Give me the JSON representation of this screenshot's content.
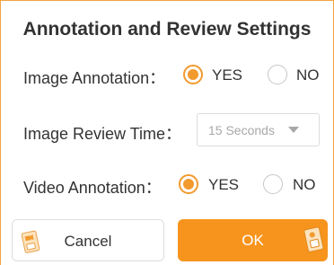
{
  "dialog": {
    "title": "Annotation and Review Settings"
  },
  "rows": {
    "image_annotation": {
      "label": "Image Annotation：",
      "yes": "YES",
      "no": "NO",
      "selected": "YES"
    },
    "review_time": {
      "label": "Image Review Time：",
      "value": "15 Seconds"
    },
    "video_annotation": {
      "label": "Video Annotation：",
      "yes": "YES",
      "no": "NO",
      "selected": "YES"
    }
  },
  "buttons": {
    "cancel": "Cancel",
    "ok": "OK"
  },
  "colors": {
    "accent": "#f7941d",
    "radio_on": "#f29a2e"
  },
  "icons": {
    "cancel": "media-card-icon",
    "ok": "media-card-icon"
  }
}
